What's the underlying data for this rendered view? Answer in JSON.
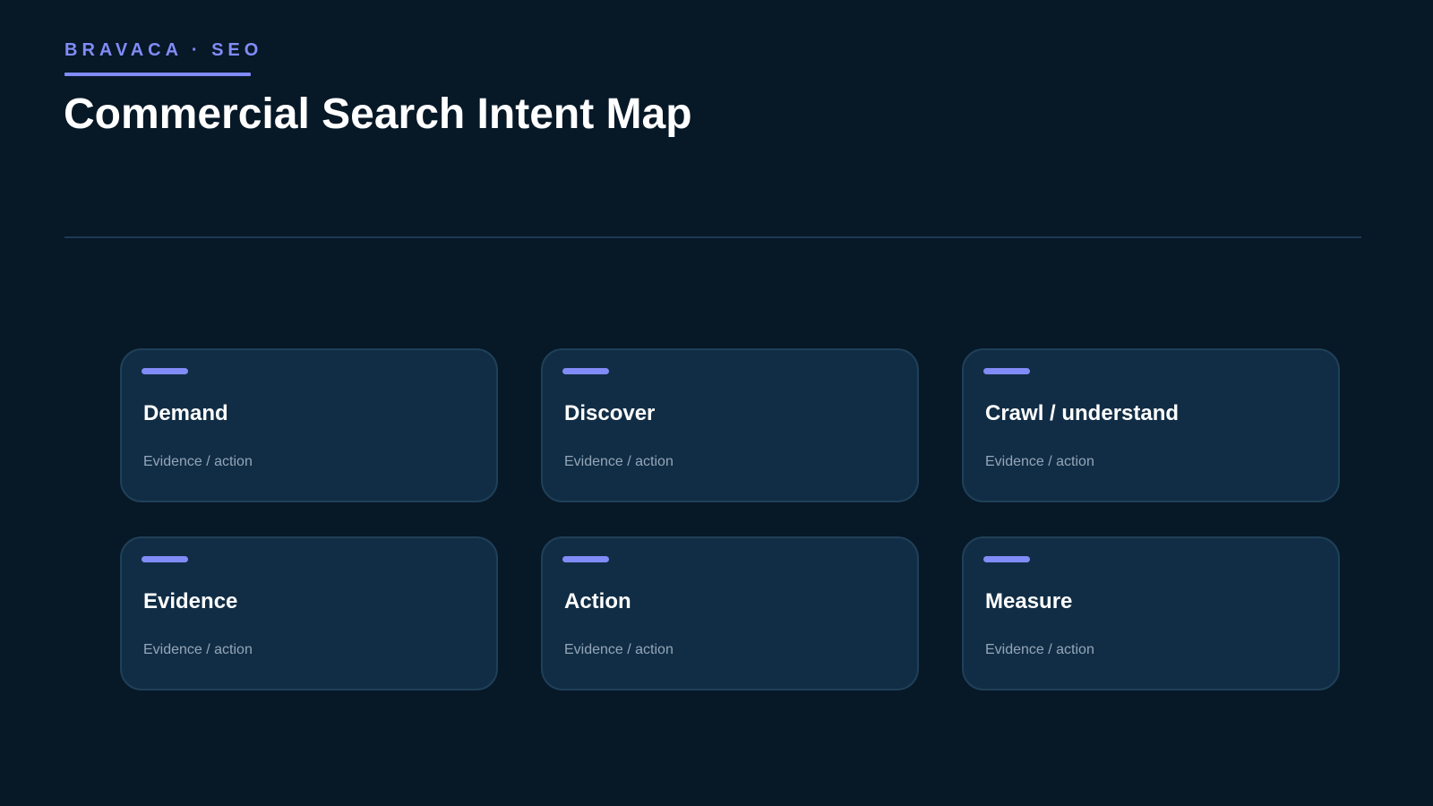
{
  "header": {
    "eyebrow": "BRAVACA · SEO",
    "title": "Commercial Search Intent Map"
  },
  "colors": {
    "background": "#071827",
    "accent": "#818cf8",
    "card_background": "#112d45",
    "card_border": "#1f4058",
    "divider": "#1e3a52",
    "subtitle_text": "#94a6b8"
  },
  "cards": [
    {
      "title": "Demand",
      "subtitle": "Evidence / action"
    },
    {
      "title": "Discover",
      "subtitle": "Evidence / action"
    },
    {
      "title": "Crawl / understand",
      "subtitle": "Evidence / action"
    },
    {
      "title": "Evidence",
      "subtitle": "Evidence / action"
    },
    {
      "title": "Action",
      "subtitle": "Evidence / action"
    },
    {
      "title": "Measure",
      "subtitle": "Evidence / action"
    }
  ]
}
